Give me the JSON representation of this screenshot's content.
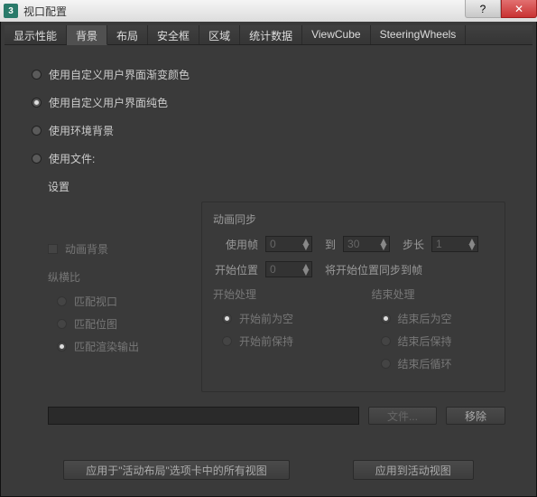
{
  "titlebar": {
    "app_glyph": "3",
    "title": "视口配置"
  },
  "tabs": [
    "显示性能",
    "背景",
    "布局",
    "安全框",
    "区域",
    "统计数据",
    "ViewCube",
    "SteeringWheels"
  ],
  "active_tab_index": 1,
  "bg": {
    "opt_gradient": "使用自定义用户界面渐变颜色",
    "opt_solid": "使用自定义用户界面纯色",
    "opt_env": "使用环境背景",
    "opt_file": "使用文件:",
    "selected": "solid"
  },
  "settings_label": "设置",
  "anim_bg_checkbox": "动画背景",
  "aspect": {
    "title": "纵横比",
    "match_viewport": "匹配视口",
    "match_bitmap": "匹配位图",
    "match_render": "匹配渲染输出"
  },
  "animsync": {
    "title": "动画同步",
    "use_frame": "使用帧",
    "use_frame_val": "0",
    "to": "到",
    "to_val": "30",
    "step": "步长",
    "step_val": "1",
    "start_pos": "开始位置",
    "start_pos_val": "0",
    "sync_to_frame": "将开始位置同步到帧"
  },
  "startproc": {
    "title": "开始处理",
    "blank_before": "开始前为空",
    "hold_before": "开始前保持"
  },
  "endproc": {
    "title": "结束处理",
    "blank_after": "结束后为空",
    "hold_after": "结束后保持",
    "loop_after": "结束后循环"
  },
  "file_btn": "文件...",
  "remove_btn": "移除",
  "apply_all_btn": "应用于\"活动布局\"选项卡中的所有视图",
  "apply_active_btn": "应用到活动视图"
}
